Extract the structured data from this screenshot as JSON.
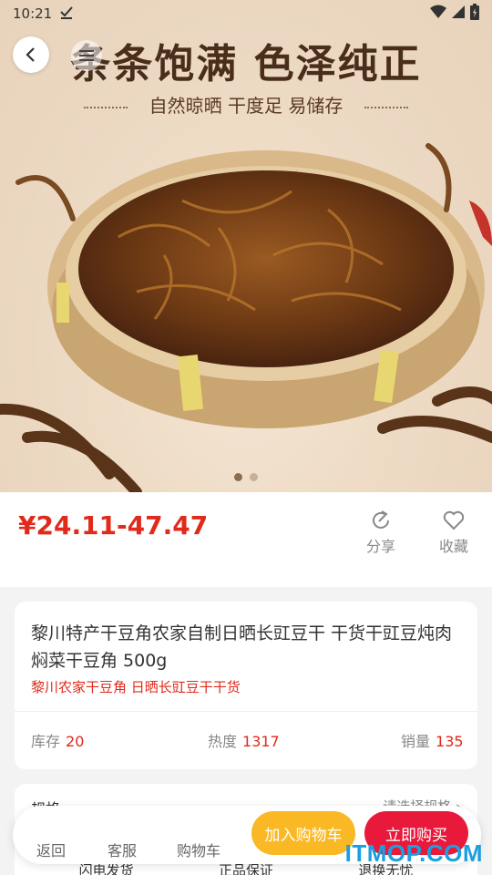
{
  "status_bar": {
    "time": "10:21"
  },
  "banner": {
    "title": "条条饱满 色泽纯正",
    "subtitle": "自然晾晒 干度足 易储存"
  },
  "price": {
    "value": "¥24.11-47.47",
    "share_label": "分享",
    "favorite_label": "收藏"
  },
  "product": {
    "title": "黎川特产干豆角农家自制日晒长豇豆干 干货干豇豆炖肉焖菜干豆角 500g",
    "subtitle": "黎川农家干豆角 日晒长豇豆干干货",
    "stats": [
      {
        "label": "库存",
        "value": "20"
      },
      {
        "label": "热度",
        "value": "1317"
      },
      {
        "label": "销量",
        "value": "135"
      }
    ]
  },
  "spec": {
    "label": "规格",
    "choose": "请选择规格 ›"
  },
  "guarantees": [
    "闪电发货",
    "正品保证",
    "退换无忧"
  ],
  "bottom_bar": {
    "back": "返回",
    "service": "客服",
    "cart": "购物车",
    "add_to_cart": "加入购物车",
    "buy_now": "立即购买"
  },
  "watermark": "ITMOP.COM",
  "colors": {
    "price_red": "#e02a1b",
    "cart_yellow": "#f9b824",
    "buy_red": "#e8193a"
  }
}
